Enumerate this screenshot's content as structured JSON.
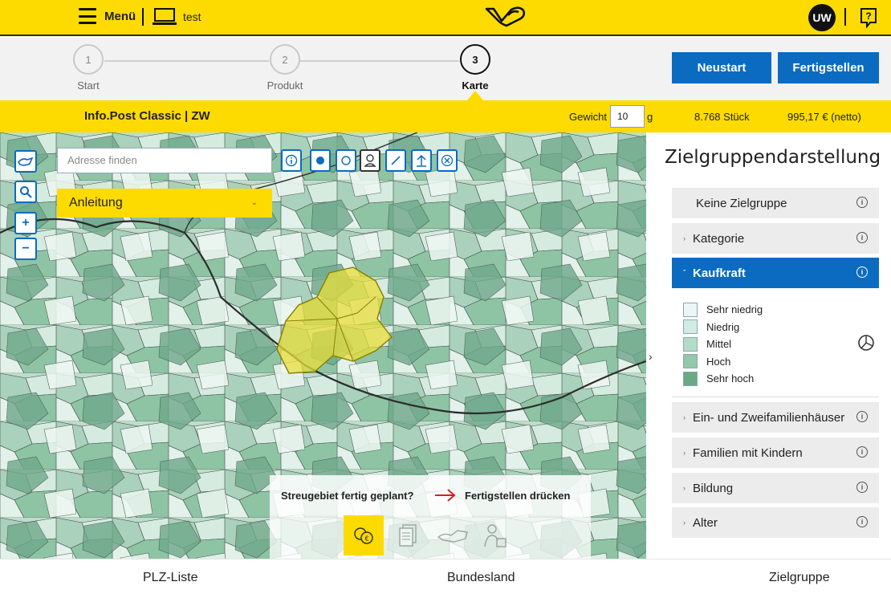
{
  "header": {
    "menu_label": "Menü",
    "project_name": "test",
    "user_initials": "UW"
  },
  "steps": [
    {
      "number": "1",
      "label": "Start"
    },
    {
      "number": "2",
      "label": "Produkt"
    },
    {
      "number": "3",
      "label": "Karte"
    }
  ],
  "actions": {
    "restart_label": "Neustart",
    "finish_label": "Fertigstellen"
  },
  "infobar": {
    "product": "Info.Post Classic | ZW",
    "weight_label": "Gewicht",
    "weight_value": "10",
    "weight_unit": "g",
    "quantity": "8.768 Stück",
    "price": "995,17 € (netto)"
  },
  "map": {
    "search_placeholder": "Adresse finden",
    "guide_label": "Anleitung",
    "hint_question": "Streugebiet fertig geplant?",
    "hint_action": "Fertigstellen drücken",
    "zoom_in": "+",
    "zoom_out": "−"
  },
  "panel": {
    "title": "Zielgruppendarstellung",
    "categories": [
      {
        "label": "Keine Zielgruppe"
      },
      {
        "label": "Kategorie"
      },
      {
        "label": "Kaufkraft"
      },
      {
        "label": "Ein- und Zweifamilienhäuser"
      },
      {
        "label": "Familien mit Kindern"
      },
      {
        "label": "Bildung"
      },
      {
        "label": "Alter"
      }
    ],
    "legend": [
      {
        "label": "Sehr niedrig",
        "color": "#eaf6f8"
      },
      {
        "label": "Niedrig",
        "color": "#d2ebe2"
      },
      {
        "label": "Mittel",
        "color": "#b3dcc8"
      },
      {
        "label": "Hoch",
        "color": "#93c8aa"
      },
      {
        "label": "Sehr hoch",
        "color": "#6aa886"
      }
    ]
  },
  "footer": {
    "plz_list": "PLZ-Liste",
    "state": "Bundesland",
    "target_group": "Zielgruppe"
  },
  "colors": {
    "brand_yellow": "#fddb00",
    "brand_blue": "#0a6bc1"
  }
}
